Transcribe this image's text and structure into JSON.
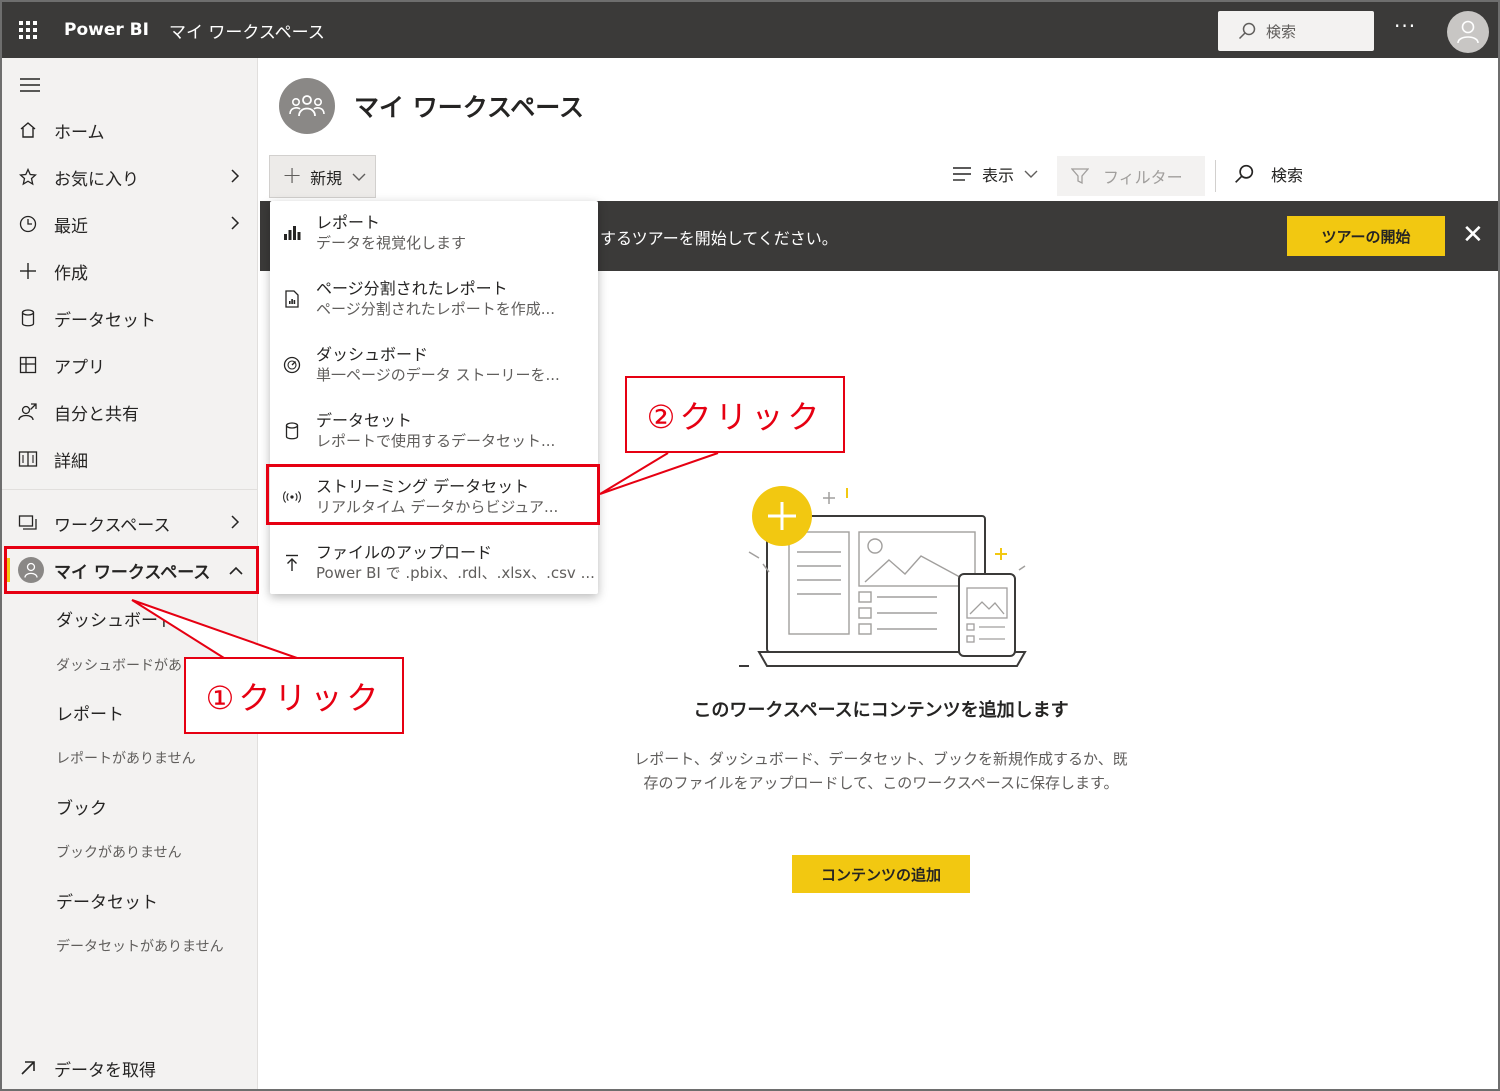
{
  "topbar": {
    "brand": "Power BI",
    "breadcrumb": "マイ ワークスペース",
    "search_placeholder": "検索",
    "more": "···"
  },
  "sidebar": {
    "items": [
      {
        "label": "ホーム"
      },
      {
        "label": "お気に入り"
      },
      {
        "label": "最近"
      },
      {
        "label": "作成"
      },
      {
        "label": "データセット"
      },
      {
        "label": "アプリ"
      },
      {
        "label": "自分と共有"
      },
      {
        "label": "詳細"
      },
      {
        "label": "ワークスペース"
      },
      {
        "label": "マイ ワークスペース"
      }
    ],
    "sub": {
      "dashboard": "ダッシュボード",
      "dashboard_empty": "ダッシュボードがあ",
      "report": "レポート",
      "report_empty": "レポートがありません",
      "book": "ブック",
      "book_empty": "ブックがありません",
      "dataset": "データセット",
      "dataset_empty": "データセットがありません"
    },
    "get_data": "データを取得"
  },
  "main": {
    "title": "マイ ワークスペース",
    "new_label": "新規",
    "view_label": "表示",
    "filter_label": "フィルター",
    "search_label": "検索",
    "banner_text": "するツアーを開始してください。",
    "tour_button": "ツアーの開始"
  },
  "dropdown": {
    "items": [
      {
        "title": "レポート",
        "desc": "データを視覚化します"
      },
      {
        "title": "ページ分割されたレポート",
        "desc": "ページ分割されたレポートを作成..."
      },
      {
        "title": "ダッシュボード",
        "desc": "単一ページのデータ ストーリーを..."
      },
      {
        "title": "データセット",
        "desc": "レポートで使用するデータセット..."
      },
      {
        "title": "ストリーミング データセット",
        "desc": "リアルタイム データからビジュア..."
      },
      {
        "title": "ファイルのアップロード",
        "desc": "Power BI で .pbix、.rdl、.xlsx、.csv ..."
      }
    ]
  },
  "callouts": {
    "first": "①クリック",
    "second": "②クリック"
  },
  "empty_state": {
    "title": "このワークスペースにコンテンツを追加します",
    "desc": "レポート、ダッシュボード、データセット、ブックを新規作成するか、既存のファイルをアップロードして、このワークスペースに保存します。",
    "button": "コンテンツの追加"
  },
  "colors": {
    "accent": "#f2c811",
    "topbar": "#3b3a39",
    "callout": "#e60012"
  }
}
